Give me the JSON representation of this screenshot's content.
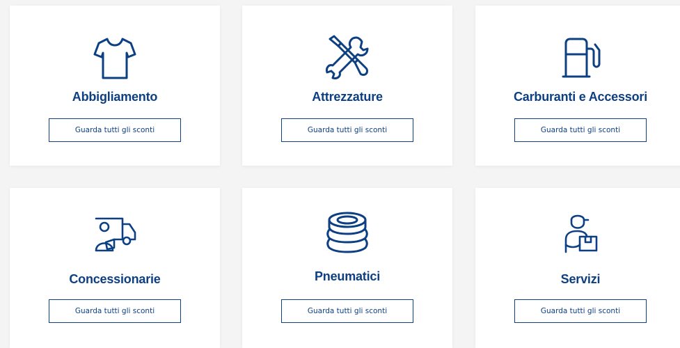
{
  "colors": {
    "brand": "#0d3f83",
    "card_bg": "#ffffff",
    "page_bg": "#f4f4f4"
  },
  "categories": [
    {
      "title": "Abbigliamento",
      "icon": "tshirt-icon",
      "button": "Guarda tutti gli sconti"
    },
    {
      "title": "Attrezzature",
      "icon": "tools-icon",
      "button": "Guarda tutti gli sconti"
    },
    {
      "title": "Carburanti e Accessori",
      "icon": "fuel-pump-icon",
      "button": "Guarda tutti gli sconti"
    },
    {
      "title": "Concessionarie",
      "icon": "delivery-truck-icon",
      "button": "Guarda tutti gli sconti"
    },
    {
      "title": "Pneumatici",
      "icon": "tires-icon",
      "button": "Guarda tutti gli sconti"
    },
    {
      "title": "Servizi",
      "icon": "delivery-person-icon",
      "button": "Guarda tutti gli sconti"
    }
  ]
}
